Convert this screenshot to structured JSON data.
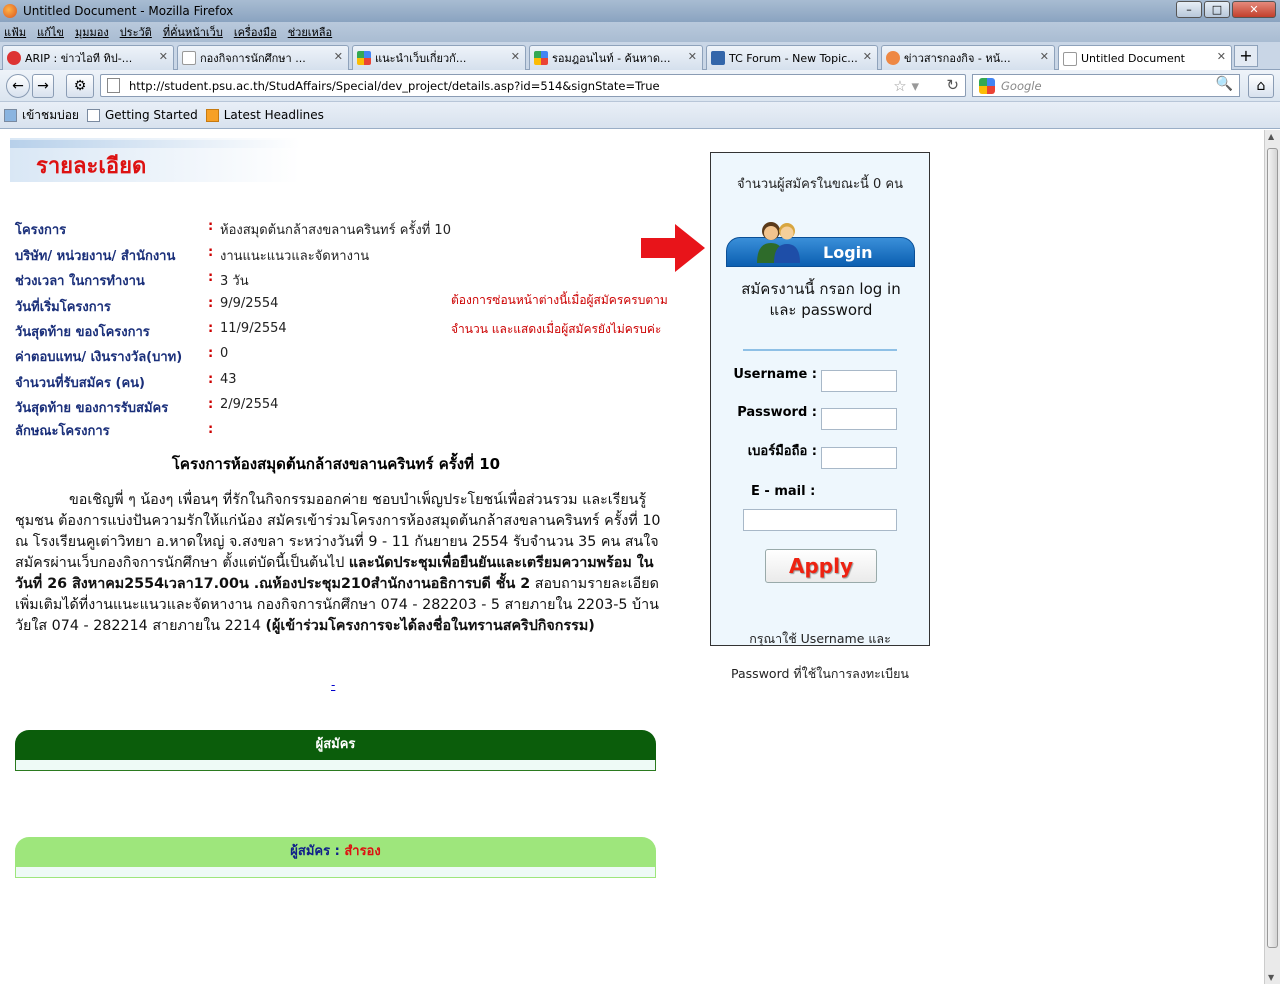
{
  "window": {
    "title": "Untitled Document - Mozilla Firefox"
  },
  "menu": [
    "แฟ้ม",
    "แก้ไข",
    "มุมมอง",
    "ประวัติ",
    "ที่คั่นหน้าเว็บ",
    "เครื่องมือ",
    "ช่วยเหลือ"
  ],
  "tabs": [
    {
      "label": "ARIP : ข่าวไอที ทิป-...",
      "color": "#d33"
    },
    {
      "label": "กองกิจการนักศึกษา ...",
      "color": "#fff"
    },
    {
      "label": "แนะนำเว็บเกี่ยวกั...",
      "color": "#4a4"
    },
    {
      "label": "รอมฎอนไนท์ - ค้นหาด...",
      "color": "#4a4"
    },
    {
      "label": "TC Forum - New Topic...",
      "color": "#36a"
    },
    {
      "label": "ข่าวสารกองกิจ - หน้...",
      "color": "#e84"
    },
    {
      "label": "Untitled Document",
      "color": "#fff"
    }
  ],
  "nav": {
    "url": "http://student.psu.ac.th/StudAffairs/Special/dev_project/details.asp?id=514&signState=True",
    "search_placeholder": "Google"
  },
  "bookmarks": [
    "เข้าชมบ่อย",
    "Getting Started",
    "Latest Headlines"
  ],
  "page": {
    "title": "รายละเอียด",
    "details": [
      {
        "label": "โครงการ",
        "colon": ":",
        "value": "ห้องสมุดต้นกล้าสงขลานครินทร์ ครั้งที่ 10"
      },
      {
        "label": "บริษัท/ หน่วยงาน/ สำนักงาน",
        "colon": ":",
        "value": "งานแนะแนวและจัดหางาน"
      },
      {
        "label": "ช่วงเวลา ในการทำงาน",
        "colon": ":",
        "value": "3 วัน"
      },
      {
        "label": "วันที่เริ่มโครงการ",
        "colon": ":",
        "value": "9/9/2554"
      },
      {
        "label": "วันสุดท้าย ของโครงการ",
        "colon": ":",
        "value": "11/9/2554"
      },
      {
        "label": "ค่าตอบแทน/ เงินรางวัล(บาท)",
        "colon": ":",
        "value": "0"
      },
      {
        "label": "จำนวนที่รับสมัคร (คน)",
        "colon": ":",
        "value": "43"
      },
      {
        "label": "วันสุดท้าย ของการรับสมัคร",
        "colon": ":",
        "value": "2/9/2554"
      },
      {
        "label": "ลักษณะโครงการ",
        "colon": ":",
        "value": ""
      }
    ],
    "note_line1": "ต้องการซ่อนหน้าต่างนี้เมื่อผู้สมัครครบตาม",
    "note_line2": "จำนวน  และแสดงเมื่อผู้สมัครยังไม่ครบค่ะ",
    "project_title": "โครงการห้องสมุดต้นกล้าสงขลานครินทร์ ครั้งที่ 10",
    "body_part1": "ขอเชิญพี่ ๆ น้องๆ เพื่อนๆ ที่รักในกิจกรรมออกค่าย ชอบบำเพ็ญประโยชน์เพื่อส่วนรวม และเรียนรู้ชุมชน ต้องการแบ่งปันความรักให้แก่น้อง สมัครเข้าร่วมโครงการห้องสมุดต้นกล้าสงขลานครินทร์ ครั้งที่ 10    ณ โรงเรียนคูเต่าวิทยา  อ.หาดใหญ่ จ.สงขลา ระหว่างวันที่ 9 - 11 กันยายน 2554 รับจำนวน 35 คน สนใจสมัครผ่านเว็บกองกิจการนักศึกษา ตั้งแต่บัดนี้เป็นต้นไป ",
    "body_bold1": "และนัดประชุมเพื่อยืนยันและเตรียมความพร้อม ในวันที่ 26 สิงหาคม2554เวลา17.00น .ณห้องประชุม210สำนักงานอธิการบดี ชั้น 2",
    "body_part2": " สอบถามรายละเอียดเพิ่มเติมได้ที่งานแนะแนวและจัดหางาน กองกิจการนักศึกษา 074 - 282203 - 5 สายภายใน 2203-5 บ้านวัยใส 074 - 282214  สายภายใน 2214  ",
    "body_bold2": "(ผู้เข้าร่วมโครงการจะได้ลงชื่อในทรานสคริปกิจกรรม)",
    "dash_link": "-",
    "applicants_header": "ผู้สมัคร",
    "reserve_header_prefix": "ผู้สมัคร : ",
    "reserve_header_suffix": "สำรอง"
  },
  "login_panel": {
    "count_text": "จำนวนผู้สมัครในขณะนี้ 0 คน",
    "banner_title": "Login",
    "signup_text": "สมัครงานนี้ กรอก log in และ password",
    "username_label": "Username :",
    "password_label": "Password :",
    "phone_label": "เบอร์มือถือ :",
    "email_label": "E - mail :",
    "apply_label": "Apply",
    "hint_line1": "กรุณาใช้ Username และ",
    "hint_line2": "Password ที่ใช้ในการลงทะเบียน"
  },
  "colors": {
    "accent_red": "#d11",
    "label_blue": "#1a2f7a",
    "dark_green": "#0b5d0b",
    "light_green": "#9ee67c"
  }
}
